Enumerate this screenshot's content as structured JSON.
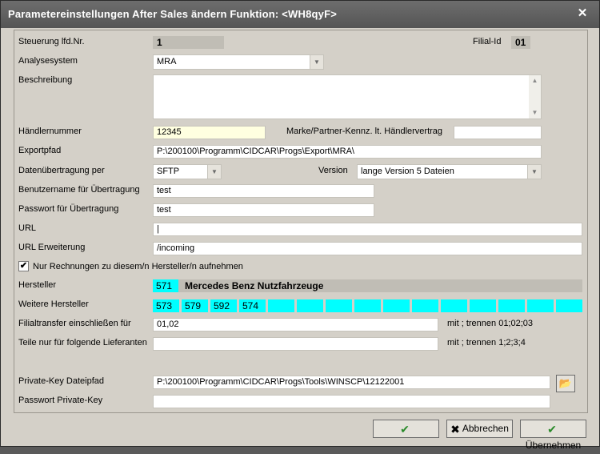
{
  "window": {
    "title": "Parametereinstellungen After Sales ändern Funktion: <WH8qyF>"
  },
  "steuerung": {
    "label": "Steuerung lfd.Nr.",
    "value": "1"
  },
  "filial": {
    "label": "Filial-Id",
    "value": "01"
  },
  "analyse": {
    "label": "Analysesystem",
    "value": "MRA"
  },
  "beschreibung": {
    "label": "Beschreibung",
    "value": ""
  },
  "haendler": {
    "label": "Händlernummer",
    "value": "12345"
  },
  "marke": {
    "label": "Marke/Partner-Kennz. lt. Händlervertrag",
    "value": ""
  },
  "exportpfad": {
    "label": "Exportpfad",
    "value": "P:\\200100\\Programm\\CIDCAR\\Progs\\Export\\MRA\\"
  },
  "transfer": {
    "label": "Datenübertragung per",
    "value": "SFTP"
  },
  "version": {
    "label": "Version",
    "value": "lange Version 5 Dateien"
  },
  "user": {
    "label": "Benutzername für Übertragung",
    "value": "test"
  },
  "password": {
    "label": "Passwort für Übertragung",
    "value": "test"
  },
  "url": {
    "label": "URL",
    "value": "|"
  },
  "url_ext": {
    "label": "URL Erweiterung",
    "value": "/incoming"
  },
  "only_invoices": {
    "label": "Nur Rechnungen zu diesem/n Hersteller/n aufnehmen",
    "checked": true,
    "mark": "✔"
  },
  "hersteller": {
    "label": "Hersteller",
    "code": "571",
    "name": "Mercedes Benz Nutzfahrzeuge"
  },
  "weitere": {
    "label": "Weitere Hersteller",
    "codes": [
      "573",
      "579",
      "592",
      "574",
      "",
      "",
      "",
      "",
      "",
      "",
      "",
      "",
      "",
      "",
      ""
    ]
  },
  "filialtransfer": {
    "label": "Filialtransfer einschließen für",
    "value": "01,02",
    "hint": "mit ; trennen 01;02;03"
  },
  "teile": {
    "label": "Teile nur für folgende Lieferanten",
    "value": "",
    "hint": "mit ; trennen 1;2;3;4"
  },
  "privatekey": {
    "label": "Private-Key Dateipfad",
    "value": "P:\\200100\\Programm\\CIDCAR\\Progs\\Tools\\WINSCP\\12122001"
  },
  "privatekey_pw": {
    "label": "Passwort Private-Key",
    "value": ""
  },
  "buttons": {
    "ok": "",
    "cancel": "Abbrechen",
    "apply": "Übernehmen"
  },
  "colors": {
    "accent_cyan": "#00ffff",
    "highlight_yellow": "#ffffe0"
  }
}
